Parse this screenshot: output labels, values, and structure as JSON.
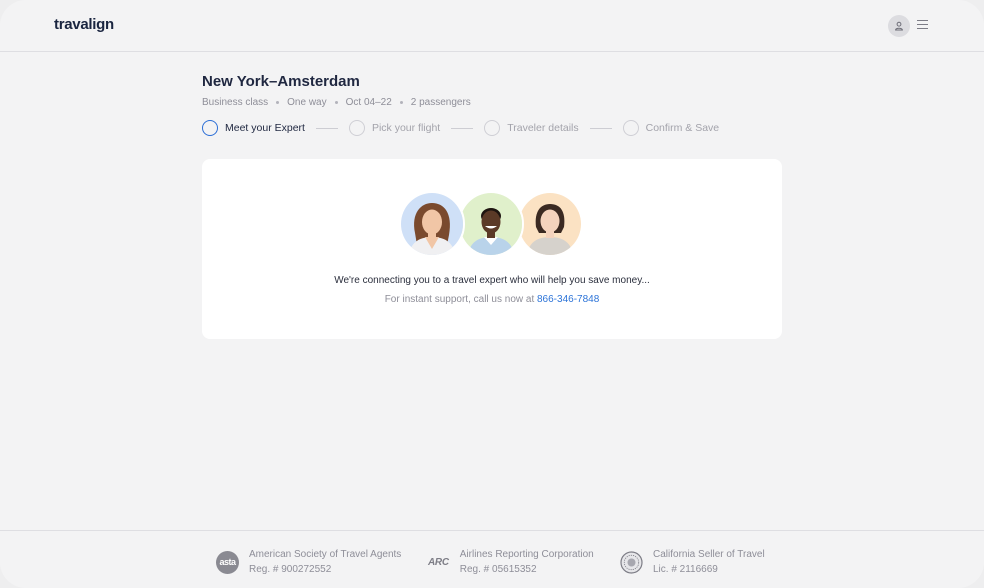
{
  "header": {
    "logo": "travalign",
    "icons": [
      "user-icon",
      "menu-icon"
    ]
  },
  "trip": {
    "route": "New York–Amsterdam",
    "meta": [
      "Business class",
      "One way",
      "Oct 04–22",
      "2 passengers"
    ]
  },
  "steps": [
    {
      "label": "Meet your Expert",
      "active": true
    },
    {
      "label": "Pick your flight",
      "active": false
    },
    {
      "label": "Traveler details",
      "active": false
    },
    {
      "label": "Confirm & Save",
      "active": false
    }
  ],
  "card": {
    "message": "We're connecting you to a travel expert who will help you save money...",
    "support_prefix": "For instant support, call us now at ",
    "phone": "866-346-7848"
  },
  "colors": {
    "accent": "#2d6fd6",
    "link": "#2d74d8",
    "title": "#1f2740"
  },
  "footer": {
    "badges": [
      {
        "icon": "asta-logo",
        "icon_text": "asta",
        "line1": "American Society of Travel Agents",
        "line2": "Reg. # 900272552"
      },
      {
        "icon": "arc-logo",
        "icon_text": "ARC",
        "line1": "Airlines Reporting Corporation",
        "line2": "Reg. # 05615352"
      },
      {
        "icon": "california-seal-icon",
        "line1": "California Seller of Travel",
        "line2": "Lic. # 2116669"
      }
    ]
  }
}
